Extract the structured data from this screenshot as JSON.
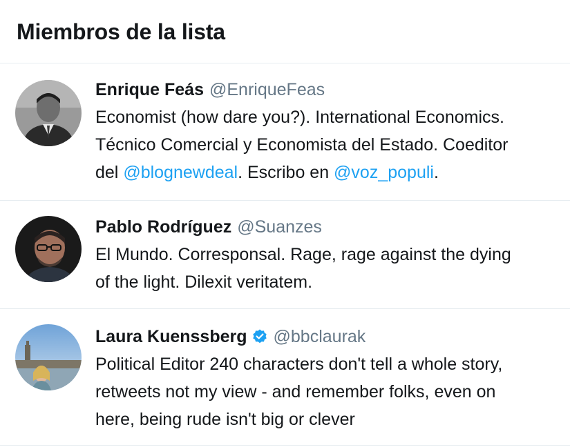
{
  "page": {
    "title": "Miembros de la lista"
  },
  "members": [
    {
      "name": "Enrique Feás",
      "handle": "@EnriqueFeas",
      "verified": false,
      "bio": {
        "line1": "Economist (how dare you?). International Economics.",
        "line2": "Técnico Comercial y Economista del Estado. Coeditor",
        "l3_prefix": "del ",
        "l3_link1": "@blognewdeal",
        "l3_middle": ". Escribo en ",
        "l3_link2": "@voz_populi",
        "l3_suffix": "."
      }
    },
    {
      "name": "Pablo Rodríguez",
      "handle": "@Suanzes",
      "verified": false,
      "bio": {
        "line1": "El Mundo. Corresponsal. Rage, rage against the dying",
        "line2": "of the light. Dilexit veritatem."
      }
    },
    {
      "name": "Laura Kuenssberg",
      "handle": "@bbclaurak",
      "verified": true,
      "bio": {
        "line1": "Political Editor 240 characters don't tell a whole story,",
        "line2": "retweets not my view - and remember folks, even on",
        "line3": "here, being rude isn't big or clever"
      }
    }
  ],
  "colors": {
    "text": "#14171a",
    "secondary": "#657786",
    "link": "#1da1f2",
    "divider": "#e6ecf0",
    "verified": "#1da1f2"
  }
}
